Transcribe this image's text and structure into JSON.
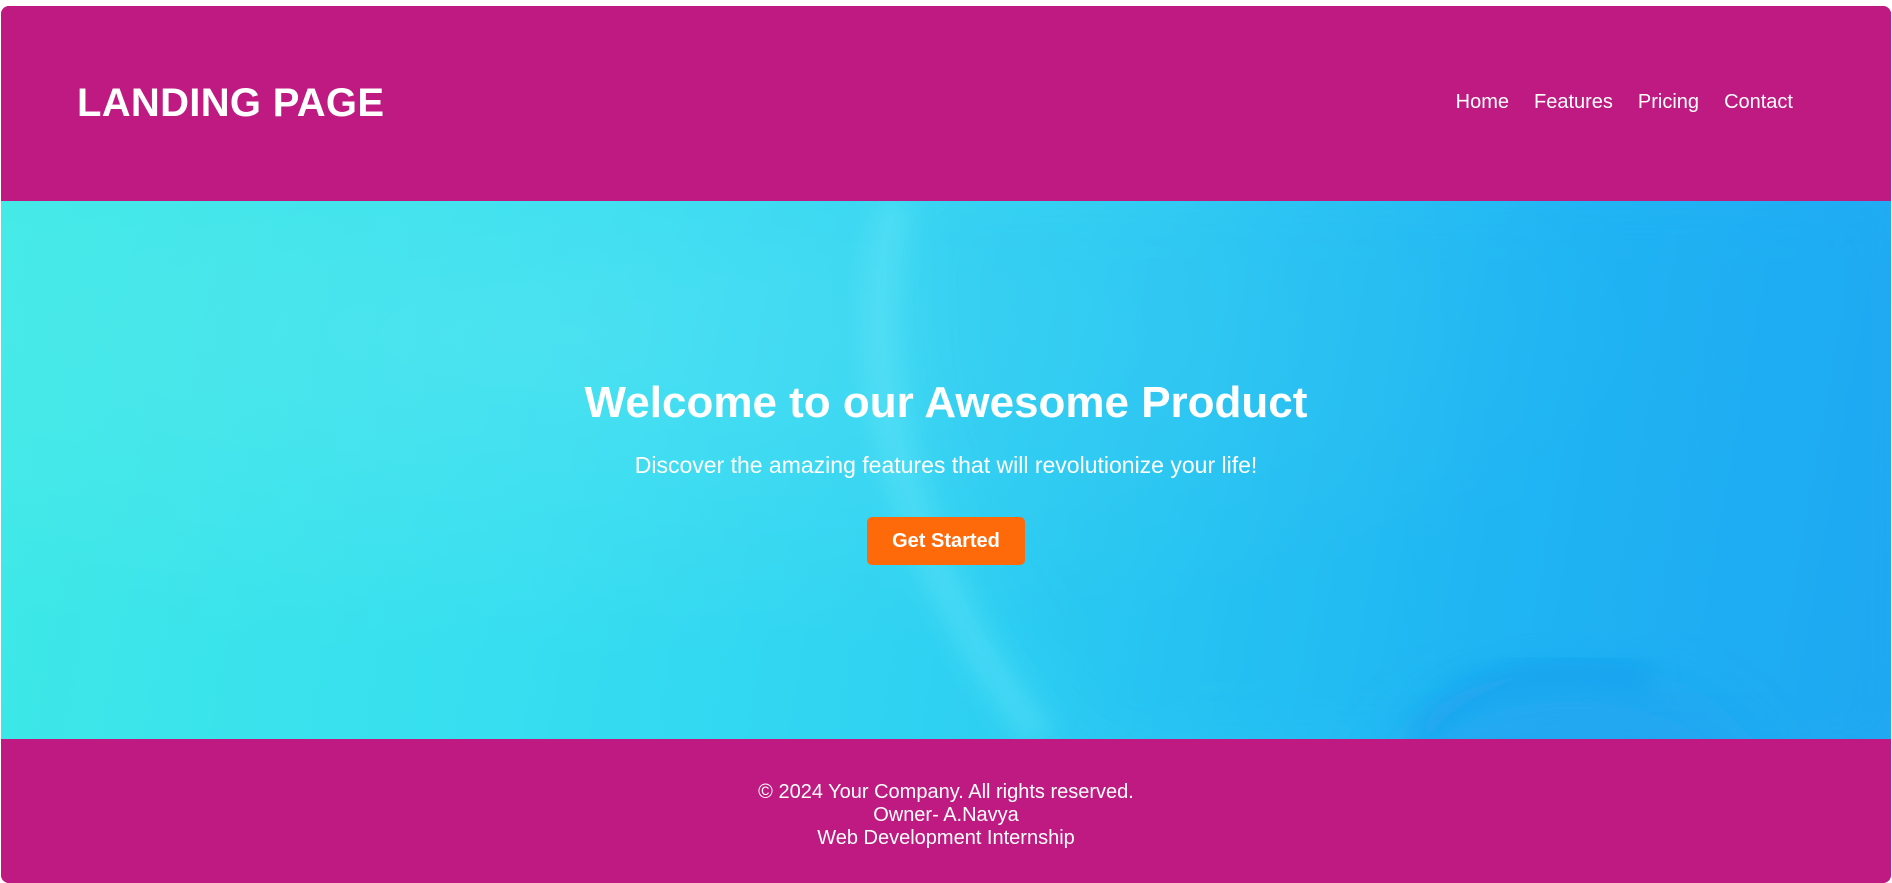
{
  "header": {
    "logo": "LANDING PAGE",
    "nav": [
      {
        "label": "Home"
      },
      {
        "label": "Features"
      },
      {
        "label": "Pricing"
      },
      {
        "label": "Contact"
      }
    ]
  },
  "hero": {
    "title": "Welcome to our Awesome Product",
    "subtitle": "Discover the amazing features that will revolutionize your life!",
    "cta_label": "Get Started"
  },
  "footer": {
    "copyright": "© 2024 Your Company. All rights reserved.",
    "owner": "Owner- A.Navya",
    "program": "Web Development Internship"
  },
  "colors": {
    "brand_magenta": "#be1a82",
    "cta_orange": "#fe6a0a",
    "hero_cyan": "#3ee9e6",
    "hero_blue": "#21a8f2",
    "text": "#ffffff"
  }
}
